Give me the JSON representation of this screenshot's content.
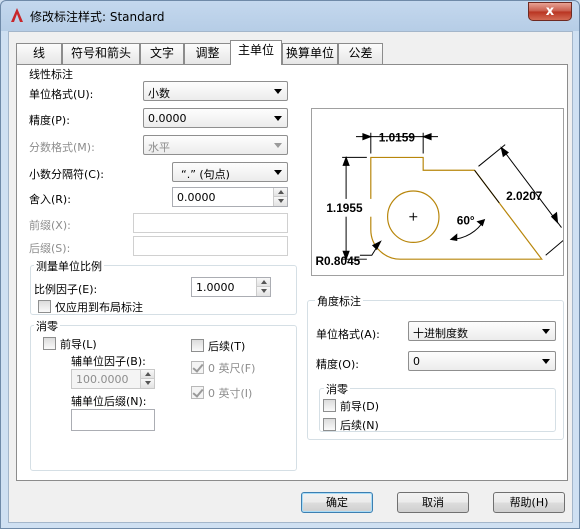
{
  "window": {
    "title": "修改标注样式: Standard",
    "close_glyph": "x"
  },
  "tabs": [
    "线",
    "符号和箭头",
    "文字",
    "调整",
    "主单位",
    "换算单位",
    "公差"
  ],
  "linear": {
    "group_title": "线性标注",
    "unit_format_label": "单位格式(U):",
    "unit_format_value": "小数",
    "precision_label": "精度(P):",
    "precision_value": "0.0000",
    "fraction_label": "分数格式(M):",
    "fraction_value": "水平",
    "separator_label": "小数分隔符(C):",
    "separator_value": "“.”  (句点)",
    "round_label": "舍入(R):",
    "round_value": "0.0000",
    "prefix_label": "前缀(X):",
    "prefix_value": "",
    "suffix_label": "后缀(S):",
    "suffix_value": ""
  },
  "scale": {
    "group_title": "测量单位比例",
    "factor_label": "比例因子(E):",
    "factor_value": "1.0000",
    "layout_only_label": "仅应用到布局标注"
  },
  "zero_linear": {
    "group_title": "消零",
    "leading_label": "前导(L)",
    "sub_factor_label": "辅单位因子(B):",
    "sub_factor_value": "100.0000",
    "sub_suffix_label": "辅单位后缀(N):",
    "sub_suffix_value": "",
    "trailing_label": "后续(T)",
    "feet_label": "0 英尺(F)",
    "inches_label": "0 英寸(I)"
  },
  "angular": {
    "group_title": "角度标注",
    "unit_format_label": "单位格式(A):",
    "unit_format_value": "十进制度数",
    "precision_label": "精度(O):",
    "precision_value": "0",
    "zero_title": "消零",
    "leading_label": "前导(D)",
    "trailing_label": "后续(N)"
  },
  "preview": {
    "dim_top": "1.0159",
    "dim_left": "1.1955",
    "dim_right": "2.0207",
    "dim_angle": "60°",
    "dim_radius": "R0.8045",
    "outline_color": "#b8860b"
  },
  "buttons": {
    "ok": "确定",
    "cancel": "取消",
    "help": "帮助(H)"
  }
}
